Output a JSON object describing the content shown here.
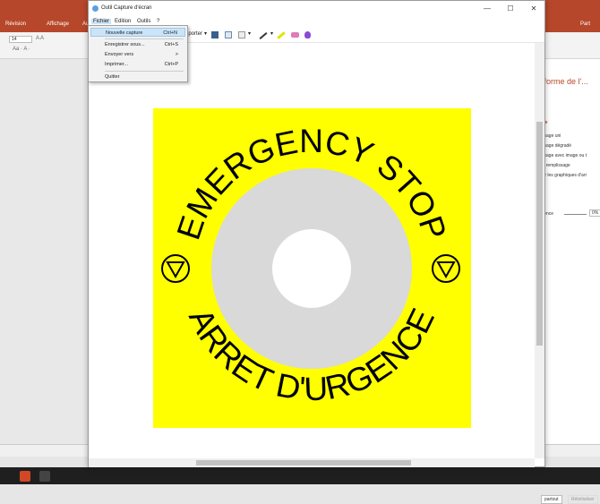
{
  "pp": {
    "tabs": [
      "Révision",
      "Affichage"
    ],
    "partial_tab": "Au",
    "share": "Part",
    "font_size": "14",
    "panel_title": "n forme de l'...",
    "panel_section": "sage",
    "panel_items": [
      "plissage uni",
      "plissage dégradé",
      "plissage avec image ou t",
      "f de remplissage",
      "quer les graphiques d'arr"
    ],
    "panel_r": "r",
    "transparence_label": "parence",
    "transparence_value": "0%",
    "btn_apply": "partout",
    "btn_reset": "Réinitialiser"
  },
  "snip": {
    "title": "Outil Capture d'écran",
    "menus": [
      "Fichier",
      "Edition",
      "Outils",
      "?"
    ],
    "toolbar_partial": "eporter",
    "dropdown": [
      {
        "label": "Nouvelle capture",
        "shortcut": "Ctrl+N"
      },
      {
        "label": "Enregistrer sous...",
        "shortcut": "Ctrl+S"
      },
      {
        "label": "Envoyer vers",
        "shortcut": ">"
      },
      {
        "label": "Imprimer...",
        "shortcut": "Ctrl+P"
      },
      {
        "label": "Quitter",
        "shortcut": ""
      }
    ]
  },
  "sign": {
    "top_text": "EMERGENCY STOP",
    "bottom_text": "ARRET D'URGENCE",
    "colors": {
      "background": "#ffff00",
      "ring": "#d9d9d9",
      "center": "#ffffff",
      "text": "#000000"
    }
  },
  "icons": [
    "save-icon",
    "copy-icon",
    "send-icon",
    "pen-icon",
    "highlighter-icon",
    "eraser-icon",
    "paint3d-icon",
    "minimize-icon",
    "maximize-icon",
    "close-icon"
  ]
}
